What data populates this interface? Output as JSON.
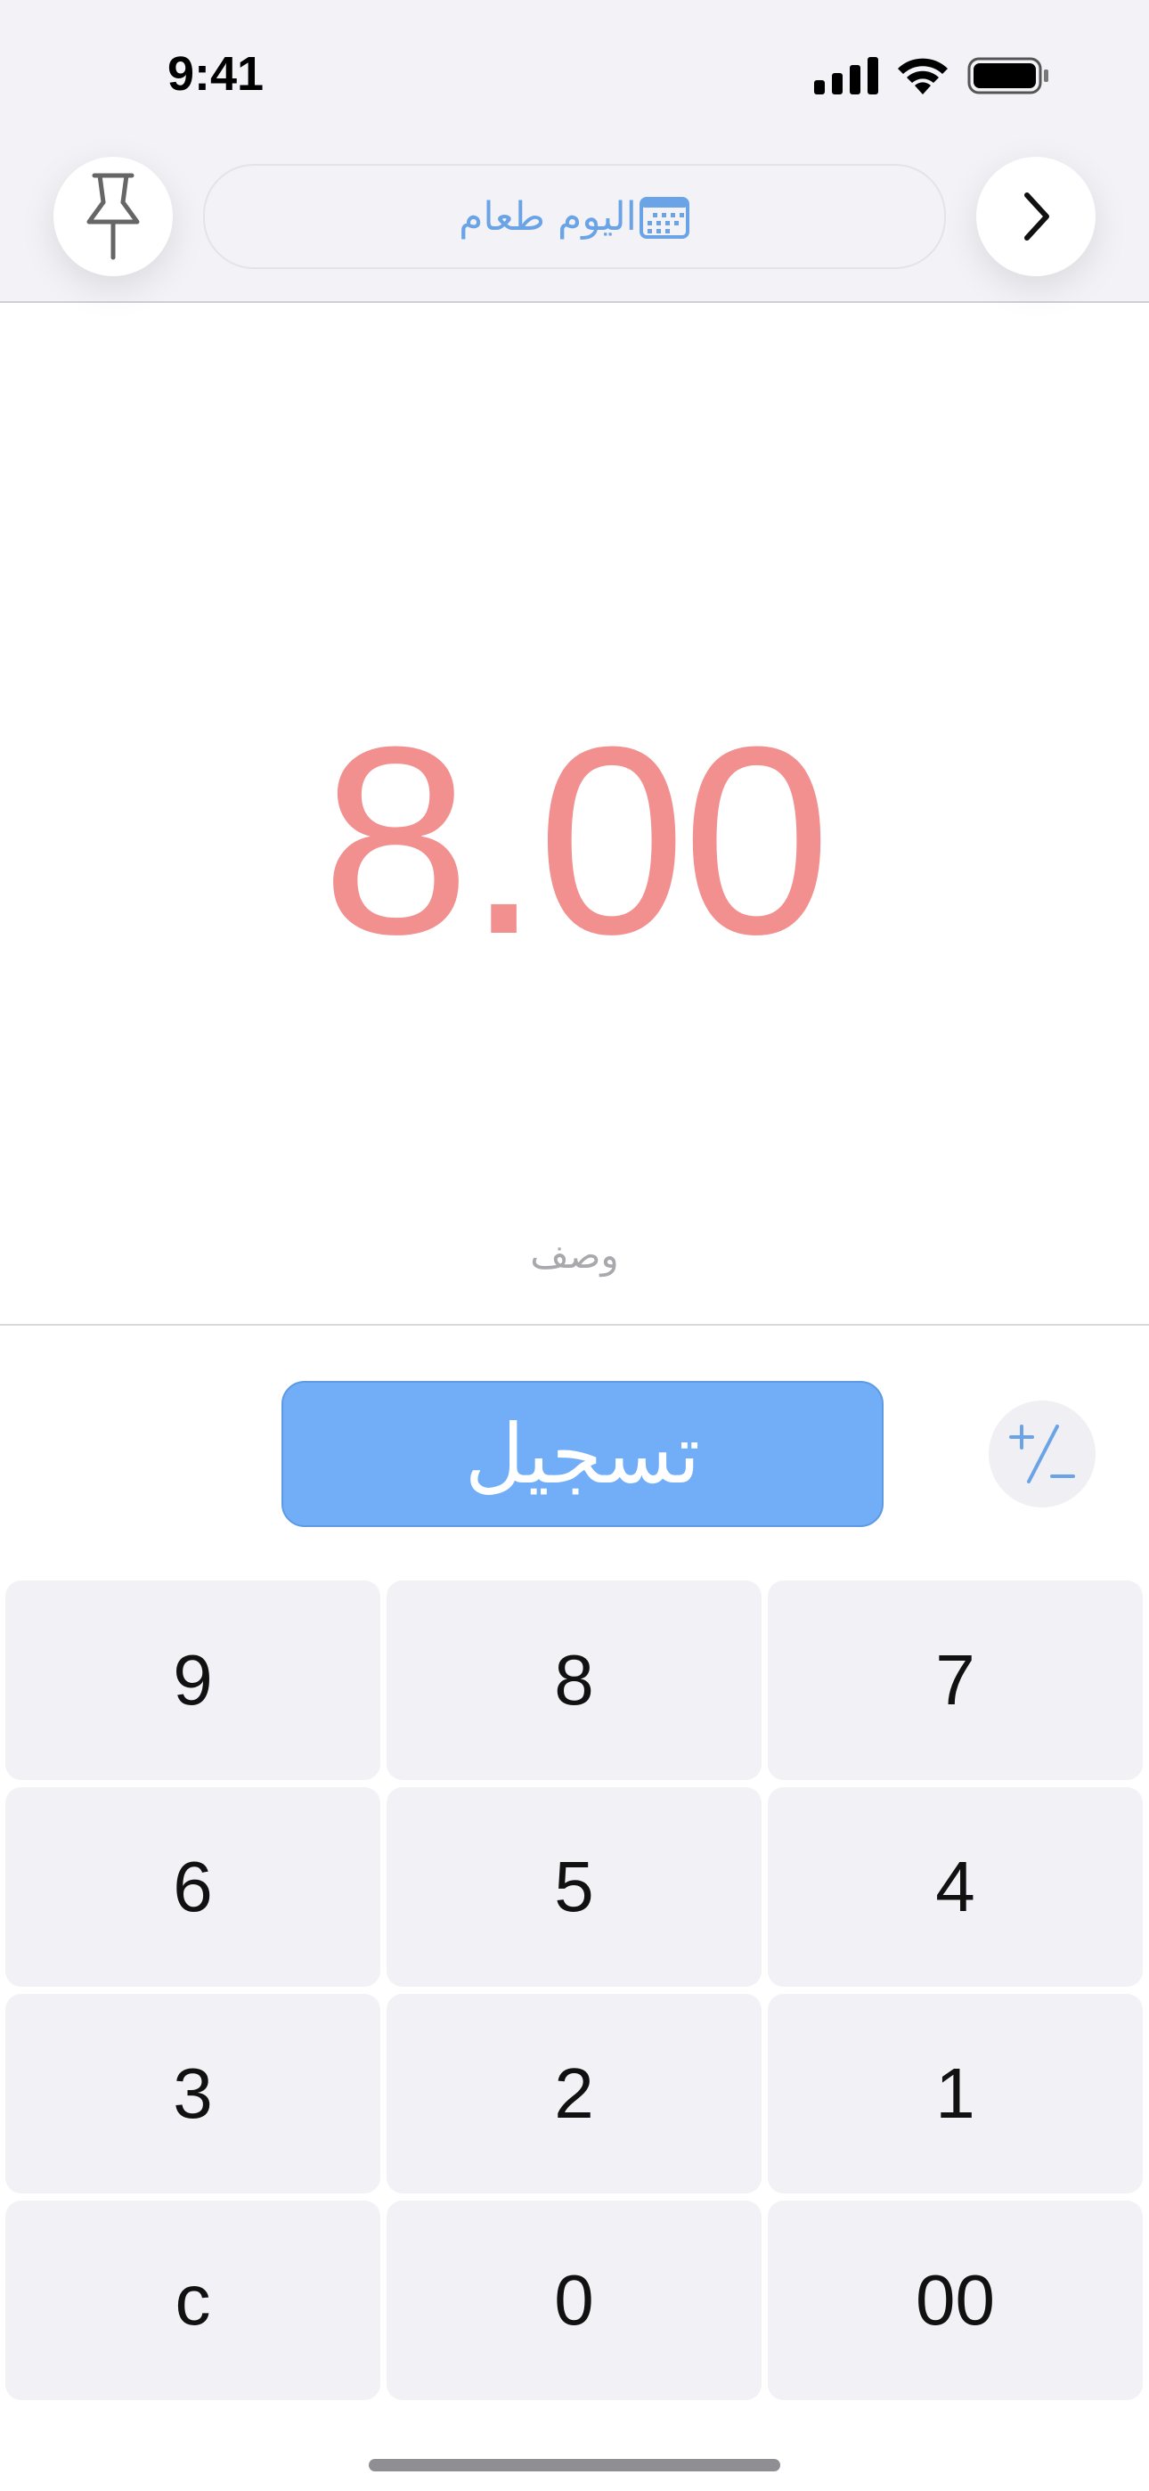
{
  "status_bar": {
    "time": "9:41",
    "icons": [
      "cellular-signal-icon",
      "wifi-icon",
      "battery-icon"
    ]
  },
  "header": {
    "pin_icon": "pushpin-icon",
    "date_label": "اليوم طعام",
    "calendar_icon": "calendar-icon",
    "next_icon": "chevron-right-icon"
  },
  "entry": {
    "amount": "8.00",
    "description_placeholder": "وصف"
  },
  "actions": {
    "save_label": "تسجيل",
    "sign_toggle_icon": "plus-minus-icon"
  },
  "keypad": {
    "keys": [
      "9",
      "8",
      "7",
      "6",
      "5",
      "4",
      "3",
      "2",
      "1",
      "c",
      "0",
      "00"
    ]
  },
  "colors": {
    "amount": "#f28f8f",
    "accent": "#71aef7",
    "header_text": "#6aa4e6",
    "key_bg": "#f1f1f6",
    "background_top": "#f2f2f7"
  }
}
